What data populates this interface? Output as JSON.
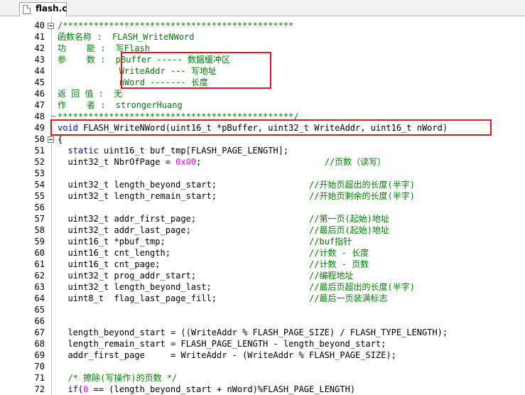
{
  "tab": {
    "label": "flash.c"
  },
  "colors": {
    "comment": "#008000",
    "keyword": "#0000ff",
    "number": "#ff00ff",
    "highlight": "#e01818"
  },
  "lines": [
    {
      "n": "40",
      "fold": "open",
      "segs": [
        {
          "t": "/*********************************************",
          "c": "comment"
        }
      ]
    },
    {
      "n": "41",
      "segs": [
        {
          "t": "函数名称 :  FLASH_WriteNWord",
          "c": "comment"
        }
      ]
    },
    {
      "n": "42",
      "segs": [
        {
          "t": "功    能 :  写Flash",
          "c": "comment"
        }
      ]
    },
    {
      "n": "43",
      "segs": [
        {
          "t": "参    数 :  pBuffer ----- 数据缓冲区",
          "c": "comment"
        }
      ]
    },
    {
      "n": "44",
      "segs": [
        {
          "t": "            WriteAddr --- 写地址",
          "c": "comment"
        }
      ]
    },
    {
      "n": "45",
      "segs": [
        {
          "t": "            nWord ------- 长度",
          "c": "comment"
        }
      ]
    },
    {
      "n": "46",
      "segs": [
        {
          "t": "返 回 值 :  无",
          "c": "comment"
        }
      ]
    },
    {
      "n": "47",
      "segs": [
        {
          "t": "作    者 :  strongerHuang",
          "c": "comment"
        }
      ]
    },
    {
      "n": "48",
      "fold": "end",
      "segs": [
        {
          "t": "**********************************************/",
          "c": "comment"
        }
      ]
    },
    {
      "n": "49",
      "segs": [
        {
          "t": "void",
          "c": "kw"
        },
        {
          "t": " FLASH_WriteNWord(uint16_t *pBuffer, uint32_t WriteAddr, uint16_t nWord)",
          "c": "ident"
        }
      ]
    },
    {
      "n": "50",
      "fold": "open",
      "segs": [
        {
          "t": "{",
          "c": "ident"
        }
      ]
    },
    {
      "n": "51",
      "segs": [
        {
          "t": "  ",
          "c": "ident"
        },
        {
          "t": "static",
          "c": "kw"
        },
        {
          "t": " uint16_t buf_tmp[FLASH_PAGE_LENGTH];",
          "c": "ident"
        }
      ]
    },
    {
      "n": "52",
      "segs": [
        {
          "t": "  uint32_t NbrOfPage = ",
          "c": "ident"
        },
        {
          "t": "0x00",
          "c": "num"
        },
        {
          "t": ";                        ",
          "c": "ident"
        },
        {
          "t": "//页数（读写）",
          "c": "comment"
        }
      ]
    },
    {
      "n": "53",
      "segs": []
    },
    {
      "n": "54",
      "segs": [
        {
          "t": "  uint32_t length_beyond_start;                  ",
          "c": "ident"
        },
        {
          "t": "//开始页超出的长度(半字)",
          "c": "comment"
        }
      ]
    },
    {
      "n": "55",
      "segs": [
        {
          "t": "  uint32_t length_remain_start;                  ",
          "c": "ident"
        },
        {
          "t": "//开始页剩余的长度(半字)",
          "c": "comment"
        }
      ]
    },
    {
      "n": "56",
      "segs": []
    },
    {
      "n": "57",
      "segs": [
        {
          "t": "  uint32_t addr_first_page;                      ",
          "c": "ident"
        },
        {
          "t": "//第一页(起始)地址",
          "c": "comment"
        }
      ]
    },
    {
      "n": "58",
      "segs": [
        {
          "t": "  uint32_t addr_last_page;                       ",
          "c": "ident"
        },
        {
          "t": "//最后页(起始)地址",
          "c": "comment"
        }
      ]
    },
    {
      "n": "59",
      "segs": [
        {
          "t": "  uint16_t *pbuf_tmp;                            ",
          "c": "ident"
        },
        {
          "t": "//buf指针",
          "c": "comment"
        }
      ]
    },
    {
      "n": "60",
      "segs": [
        {
          "t": "  uint16_t cnt_length;                           ",
          "c": "ident"
        },
        {
          "t": "//计数 - 长度",
          "c": "comment"
        }
      ]
    },
    {
      "n": "61",
      "segs": [
        {
          "t": "  uint16_t cnt_page;                             ",
          "c": "ident"
        },
        {
          "t": "//计数 - 页数",
          "c": "comment"
        }
      ]
    },
    {
      "n": "62",
      "segs": [
        {
          "t": "  uint32_t prog_addr_start;                      ",
          "c": "ident"
        },
        {
          "t": "//编程地址",
          "c": "comment"
        }
      ]
    },
    {
      "n": "63",
      "segs": [
        {
          "t": "  uint32_t length_beyond_last;                   ",
          "c": "ident"
        },
        {
          "t": "//最后页超出的长度(半字)",
          "c": "comment"
        }
      ]
    },
    {
      "n": "64",
      "segs": [
        {
          "t": "  uint8_t  flag_last_page_fill;                  ",
          "c": "ident"
        },
        {
          "t": "//最后一页装满标志",
          "c": "comment"
        }
      ]
    },
    {
      "n": "65",
      "segs": []
    },
    {
      "n": "66",
      "segs": []
    },
    {
      "n": "67",
      "segs": [
        {
          "t": "  length_beyond_start = ((WriteAddr % FLASH_PAGE_SIZE) / FLASH_TYPE_LENGTH);",
          "c": "ident"
        }
      ]
    },
    {
      "n": "68",
      "segs": [
        {
          "t": "  length_remain_start = FLASH_PAGE_LENGTH - length_beyond_start;",
          "c": "ident"
        }
      ]
    },
    {
      "n": "69",
      "segs": [
        {
          "t": "  addr_first_page     = WriteAddr - (WriteAddr % FLASH_PAGE_SIZE);",
          "c": "ident"
        }
      ]
    },
    {
      "n": "70",
      "segs": []
    },
    {
      "n": "71",
      "segs": [
        {
          "t": "  ",
          "c": "ident"
        },
        {
          "t": "/* 擦除(写操作)的页数 */",
          "c": "comment"
        }
      ]
    },
    {
      "n": "72",
      "segs": [
        {
          "t": "  ",
          "c": "ident"
        },
        {
          "t": "if",
          "c": "kw"
        },
        {
          "t": "(",
          "c": "ident"
        },
        {
          "t": "0",
          "c": "num"
        },
        {
          "t": " == (length_beyond_start + nWord)%FLASH_PAGE_LENGTH)",
          "c": "ident"
        }
      ]
    }
  ]
}
